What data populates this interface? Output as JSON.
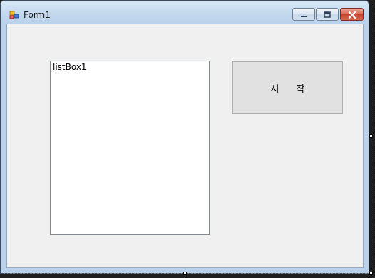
{
  "window": {
    "title": "Form1",
    "app_icon": "winforms-form-icon",
    "controls": {
      "minimize_icon": "minimize-icon",
      "maximize_icon": "maximize-icon",
      "close_icon": "close-icon"
    }
  },
  "form": {
    "listbox": {
      "label": "listBox1"
    },
    "start_button": {
      "label": "시 작"
    }
  },
  "colors": {
    "title_bar": "#c3d8ee",
    "client_background": "#f0f0f0",
    "close_button": "#c4432d",
    "button_face": "#e1e1e1"
  }
}
